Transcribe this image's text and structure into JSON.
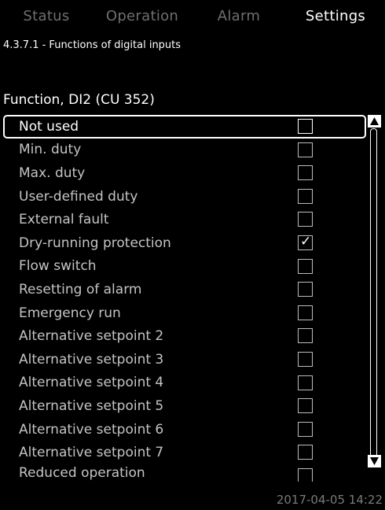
{
  "tabs": [
    {
      "label": "Status",
      "active": false
    },
    {
      "label": "Operation",
      "active": false
    },
    {
      "label": "Alarm",
      "active": false
    },
    {
      "label": "Settings",
      "active": true
    }
  ],
  "menu_path": "4.3.7.1 - Functions of digital inputs",
  "function_header": "Function, DI2 (CU 352)",
  "options": [
    {
      "label": "Not used",
      "checked": false,
      "selected": true
    },
    {
      "label": "Min. duty",
      "checked": false
    },
    {
      "label": "Max. duty",
      "checked": false
    },
    {
      "label": "User-defined duty",
      "checked": false
    },
    {
      "label": "External fault",
      "checked": false
    },
    {
      "label": "Dry-running protection",
      "checked": true
    },
    {
      "label": "Flow switch",
      "checked": false
    },
    {
      "label": "Resetting of alarm",
      "checked": false
    },
    {
      "label": "Emergency run",
      "checked": false
    },
    {
      "label": "Alternative setpoint 2",
      "checked": false
    },
    {
      "label": "Alternative setpoint 3",
      "checked": false
    },
    {
      "label": "Alternative setpoint 4",
      "checked": false
    },
    {
      "label": "Alternative setpoint 5",
      "checked": false
    },
    {
      "label": "Alternative setpoint 6",
      "checked": false
    },
    {
      "label": "Alternative setpoint 7",
      "checked": false
    },
    {
      "label": "Reduced operation",
      "checked": false
    }
  ],
  "check_mark": "✓",
  "timestamp": "2017-04-05 14:22",
  "icons": {
    "scroll_up": "scroll-up-arrow-icon",
    "scroll_down": "scroll-down-arrow-icon"
  },
  "colors": {
    "background": "#000000",
    "text": "#ffffff",
    "inactive_tab": "#6f6f6f",
    "timestamp": "#7a7a7a"
  }
}
